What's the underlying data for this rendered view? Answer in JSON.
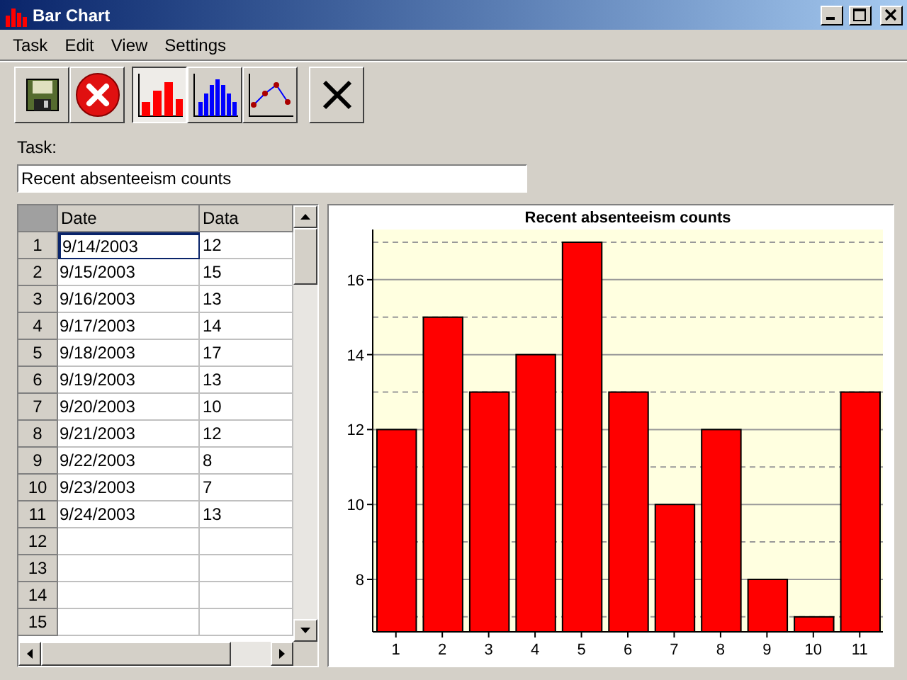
{
  "window": {
    "title": "Bar Chart"
  },
  "menu": [
    "Task",
    "Edit",
    "View",
    "Settings"
  ],
  "toolbar": [
    {
      "kind": "save",
      "selected": false
    },
    {
      "kind": "cancel",
      "selected": false
    },
    {
      "kind": "bar",
      "selected": true
    },
    {
      "kind": "histogram",
      "selected": false
    },
    {
      "kind": "line",
      "selected": false
    },
    {
      "kind": "close",
      "selected": false
    }
  ],
  "task": {
    "label": "Task:",
    "value": "Recent absenteeism counts"
  },
  "table": {
    "columns": [
      "Date",
      "Data"
    ],
    "rows": [
      {
        "number": "1",
        "date": "9/14/2003",
        "data": "12",
        "selected": true
      },
      {
        "number": "2",
        "date": "9/15/2003",
        "data": "15",
        "selected": false
      },
      {
        "number": "3",
        "date": "9/16/2003",
        "data": "13",
        "selected": false
      },
      {
        "number": "4",
        "date": "9/17/2003",
        "data": "14",
        "selected": false
      },
      {
        "number": "5",
        "date": "9/18/2003",
        "data": "17",
        "selected": false
      },
      {
        "number": "6",
        "date": "9/19/2003",
        "data": "13",
        "selected": false
      },
      {
        "number": "7",
        "date": "9/20/2003",
        "data": "10",
        "selected": false
      },
      {
        "number": "8",
        "date": "9/21/2003",
        "data": "12",
        "selected": false
      },
      {
        "number": "9",
        "date": "9/22/2003",
        "data": "8",
        "selected": false
      },
      {
        "number": "10",
        "date": "9/23/2003",
        "data": "7",
        "selected": false
      },
      {
        "number": "11",
        "date": "9/24/2003",
        "data": "13",
        "selected": false
      },
      {
        "number": "12",
        "selected": false
      },
      {
        "number": "13",
        "selected": false
      },
      {
        "number": "14",
        "selected": false
      },
      {
        "number": "15",
        "selected": false
      }
    ]
  },
  "chart": {
    "chart_data": {
      "type": "bar",
      "title": "Recent absenteeism counts",
      "categories": [
        "1",
        "2",
        "3",
        "4",
        "5",
        "6",
        "7",
        "8",
        "9",
        "10",
        "11"
      ],
      "grid": true,
      "series": [
        {
          "color": "#ff0000",
          "values": [
            12,
            15,
            13,
            14,
            17,
            13,
            10,
            12,
            8,
            7,
            13
          ]
        }
      ],
      "ylim": [
        6.6,
        17.34
      ],
      "yticks": [
        8,
        10,
        12,
        14,
        16
      ]
    }
  }
}
